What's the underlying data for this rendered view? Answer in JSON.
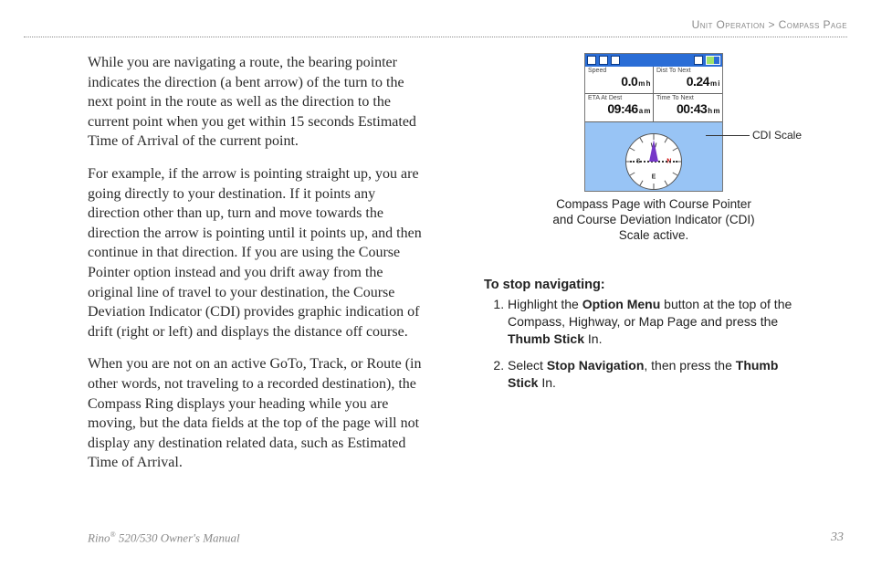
{
  "breadcrumb": {
    "section": "Unit Operation",
    "sep": " > ",
    "page": "Compass Page"
  },
  "left": {
    "p1": "While you are navigating a route, the bearing pointer indicates the direction (a bent arrow) of the turn to the next point in the route as well as the direction to the current point when you get within 15 seconds Estimated Time of Arrival of the current point.",
    "p2": "For example, if the arrow is pointing straight up, you are going directly to your destination. If it points any direction other than up, turn and move towards the direction the arrow is pointing until it points up, and then continue in that direction. If you are using the Course Pointer option instead and you drift away from the original line of travel to your destination, the Course Deviation Indicator (CDI) provides graphic indication of drift (right or left) and displays the distance off course.",
    "p3": "When you are not on an active GoTo, Track, or Route (in other words, not traveling to a recorded destination), the Compass Ring displays your heading while you are moving, but the data fields at the top of the page will not display any destination related data, such as Estimated Time of Arrival."
  },
  "device": {
    "fields": {
      "speed": {
        "label": "Speed",
        "value": "0.0",
        "unit": "m h"
      },
      "dist": {
        "label": "Dist To Next",
        "value": "0.24",
        "unit": "m i"
      },
      "eta": {
        "label": "ETA At Dest",
        "value": "09:46",
        "unit": "a m"
      },
      "time": {
        "label": "Time To Next",
        "value": "00:43",
        "unit": "h m"
      }
    },
    "cardinals": {
      "n": "N",
      "s": "S",
      "e": "E",
      "w": "W"
    }
  },
  "callout": {
    "label": "CDI Scale"
  },
  "caption": "Compass Page with Course Pointer and Course Deviation Indicator (CDI) Scale active.",
  "instr": {
    "heading": "To stop navigating:",
    "step1_a": "Highlight the ",
    "step1_b": "Option Menu",
    "step1_c": " button at the top of the Compass, Highway, or Map Page and press the ",
    "step1_d": "Thumb Stick",
    "step1_e": " In.",
    "step2_a": "Select ",
    "step2_b": "Stop Navigation",
    "step2_c": ", then press the ",
    "step2_d": "Thumb Stick",
    "step2_e": " In."
  },
  "footer": {
    "product_a": "Rino",
    "product_reg": "®",
    "product_b": " 520/530 Owner's Manual",
    "page_num": "33"
  }
}
